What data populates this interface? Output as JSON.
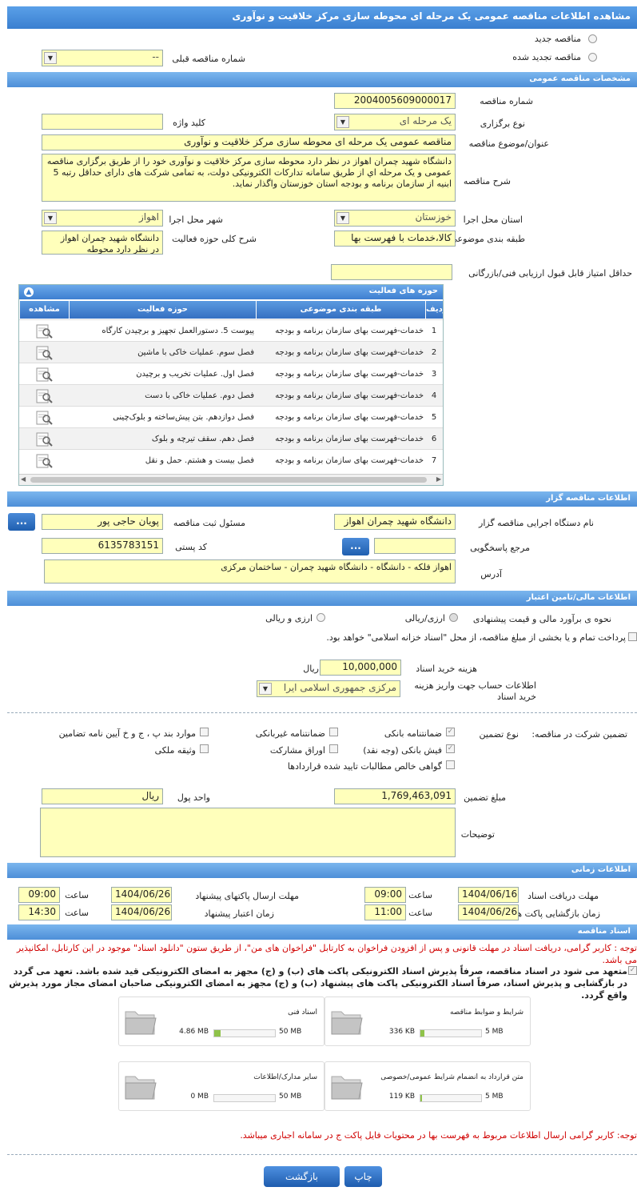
{
  "title": "مشاهده اطلاعات مناقصه عمومی یک مرحله ای محوطه سازی مرکز خلاقیت و نوآوری",
  "tender_type": {
    "new_label": "مناقصه جدید",
    "renewed_label": "مناقصه تجدید شده",
    "prev_number_label": "شماره مناقصه قبلی",
    "prev_number_value": "--"
  },
  "general": {
    "header": "مشخصات مناقصه عمومی",
    "number_label": "شماره مناقصه",
    "number_value": "2004005609000017",
    "holding_type_label": "نوع برگزاری",
    "holding_type_value": "یک مرحله ای",
    "keyword_label": "کلید واژه",
    "keyword_value": "",
    "subject_label": "عنوان/موضوع مناقصه",
    "subject_value": "مناقصه عمومی یک مرحله ای محوطه سازی  مرکز خلاقیت و نوآوری",
    "description_label": "شرح مناقصه",
    "description_value": "دانشگاه شهید چمران اهواز در نظر دارد محوطه سازی مرکز خلاقیت و نوآوری خود را از طریق برگزاری مناقصه عمومی و یک  مرحله اي از طریق سامانه تدارکات الکترونیکی دولت، به تمامی شرکت های دارای حداقل رتبه 5 ابنیه از سازمان برنامه و بودجه استان خوزستان واگذار نماید.",
    "province_label": "استان محل اجرا",
    "province_value": "خوزستان",
    "city_label": "شهر محل اجرا",
    "city_value": "اهواز",
    "category_label": "طبقه بندی موضوعی",
    "category_value": "کالا،خدمات با فهرست بها",
    "activity_desc_label": "شرح کلی حوزه فعالیت",
    "activity_desc_value": "دانشگاه شهید چمران اهواز در نظر دارد محوطه",
    "min_score_label": "حداقل امتیاز قابل قبول ارزیابی فنی/بازرگانی",
    "min_score_value": ""
  },
  "activities": {
    "header": "حوزه های فعالیت",
    "columns": [
      "ردیف",
      "طبقه بندی موضوعی",
      "حوزه فعالیت",
      "مشاهده"
    ],
    "rows": [
      {
        "n": "1",
        "cat": "خدمات-فهرست بهای سازمان برنامه و بودجه",
        "area": "پیوست 5. دستورالعمل تجهیز و برچیدن کارگاه"
      },
      {
        "n": "2",
        "cat": "خدمات-فهرست بهای سازمان برنامه و بودجه",
        "area": "فصل سوم. عملیات خاکی با ماشین"
      },
      {
        "n": "3",
        "cat": "خدمات-فهرست بهای سازمان برنامه و بودجه",
        "area": "فصل اول. عملیات تخریب و برچیدن"
      },
      {
        "n": "4",
        "cat": "خدمات-فهرست بهای سازمان برنامه و بودجه",
        "area": "فصل دوم. عملیات خاکی با دست"
      },
      {
        "n": "5",
        "cat": "خدمات-فهرست بهای سازمان برنامه و بودجه",
        "area": "فصل دوازدهم. بتن پیش‌ساخته و بلوک‌چینی"
      },
      {
        "n": "6",
        "cat": "خدمات-فهرست بهای سازمان برنامه و بودجه",
        "area": "فصل دهم. سقف تیرچه و بلوک"
      },
      {
        "n": "7",
        "cat": "خدمات-فهرست بهای سازمان برنامه و بودجه",
        "area": "فصل بیست و هشتم. حمل و نقل"
      }
    ]
  },
  "organizer": {
    "header": "اطلاعات مناقصه گزار",
    "org_label": "نام دستگاه اجرایی مناقصه گزار",
    "org_value": "دانشگاه شهید چمران اهواز",
    "registrar_label": "مسئول ثبت مناقصه",
    "registrar_value": "پویان حاجی پور",
    "ref_label": "مرجع پاسخگویی",
    "ref_value": "",
    "postal_label": "کد پستی",
    "postal_value": "6135783151",
    "address_label": "آدرس",
    "address_value": "اهواز فلکه - دانشگاه - دانشگاه شهید چمران - ساختمان مرکزی",
    "dots_label": "..."
  },
  "financial": {
    "header": "اطلاعات مالی/تامین اعتبار",
    "estimate_label": "نحوه ی برآورد مالی و قیمت پیشنهادی",
    "opt1": "ارزی/ریالی",
    "opt2": "ارزی و ریالی",
    "treasury_text": "پرداخت تمام و یا بخشی از مبلغ مناقصه، از محل \"اسناد خزانه اسلامی\" خواهد بود.",
    "fee_label": "هزینه خرید اسناد",
    "fee_value": "10,000,000",
    "fee_unit": "ریال",
    "account_label": "اطلاعات حساب جهت واریز هزینه خرید اسناد",
    "account_value": "مرکزی جمهوری اسلامی ایرا"
  },
  "guarantee": {
    "label": "تضمین شرکت در مناقصه:",
    "type_label": "نوع تضمین",
    "opts": [
      "ضمانتنامه بانکی",
      "ضمانتنامه غیربانکی",
      "موارد بند پ ، ج و خ آیین نامه تضامین",
      "فیش بانکی (وجه نقد)",
      "اوراق مشارکت",
      "وثیقه ملکی",
      "گواهی خالص مطالبات تایید شده قراردادها"
    ],
    "amount_label": "مبلغ تضمین",
    "amount_value": "1,769,463,091",
    "currency_label": "واحد پول",
    "currency_value": "ریال",
    "notes_label": "توضیحات",
    "notes_value": ""
  },
  "timing": {
    "header": "اطلاعات زمانی",
    "doc_receive_label": "مهلت دریافت اسناد",
    "doc_receive_date": "1404/06/16",
    "doc_receive_time": "09:00",
    "submit_label": "مهلت ارسال پاکتهای پیشنهاد",
    "submit_date": "1404/06/26",
    "submit_time": "09:00",
    "open_label": "زمان بازگشایی پاکت ها",
    "open_date": "1404/06/26",
    "open_time": "11:00",
    "validity_label": "زمان اعتبار پیشنهاد",
    "validity_date": "1404/06/26",
    "validity_time": "14:30",
    "time_label": "ساعت"
  },
  "documents": {
    "header": "اسناد مناقصه",
    "note1": "توجه : کاربر گرامی، دریافت اسناد در مهلت قانونی و پس از افزودن فراخوان به کارتابل \"فراخوان های من\"، از طریق ستون \"دانلود اسناد\" موجود در این کارتابل، امکانپذیر می باشد.",
    "commit_text": "متعهد می شود در اسناد مناقصه، صرفاً پذیرش اسناد الکترونیکی پاکت های (ب) و (ج) مجهز به امضای الکترونیکی قید شده باشد. تعهد می گردد در بازگشایی و پذیرش اسناد، صرفاً اسناد الکترونیکی پاکت های پیشنهاد (ب) و (ج) مجهز به امضای الکترونیکی صاحبان امضای مجاز مورد پذیرش واقع گردد.",
    "cards": [
      {
        "name": "شرایط و ضوابط مناقصه",
        "size": "336 KB",
        "max": "5 MB",
        "fill": 0.07
      },
      {
        "name": "اسناد فنی",
        "size": "4.86 MB",
        "max": "50 MB",
        "fill": 0.1
      },
      {
        "name": "متن قرارداد به انضمام شرایط عمومی/خصوصی",
        "size": "119 KB",
        "max": "5 MB",
        "fill": 0.03
      },
      {
        "name": "سایر مدارک/اطلاعات",
        "size": "0 MB",
        "max": "50 MB",
        "fill": 0
      }
    ],
    "note2": "توجه: کاربر گرامی ارسال اطلاعات مربوط به فهرست بها در محتویات فایل پاکت ج در سامانه اجباری میباشد."
  },
  "actions": {
    "print": "چاپ",
    "back": "بازگشت"
  }
}
